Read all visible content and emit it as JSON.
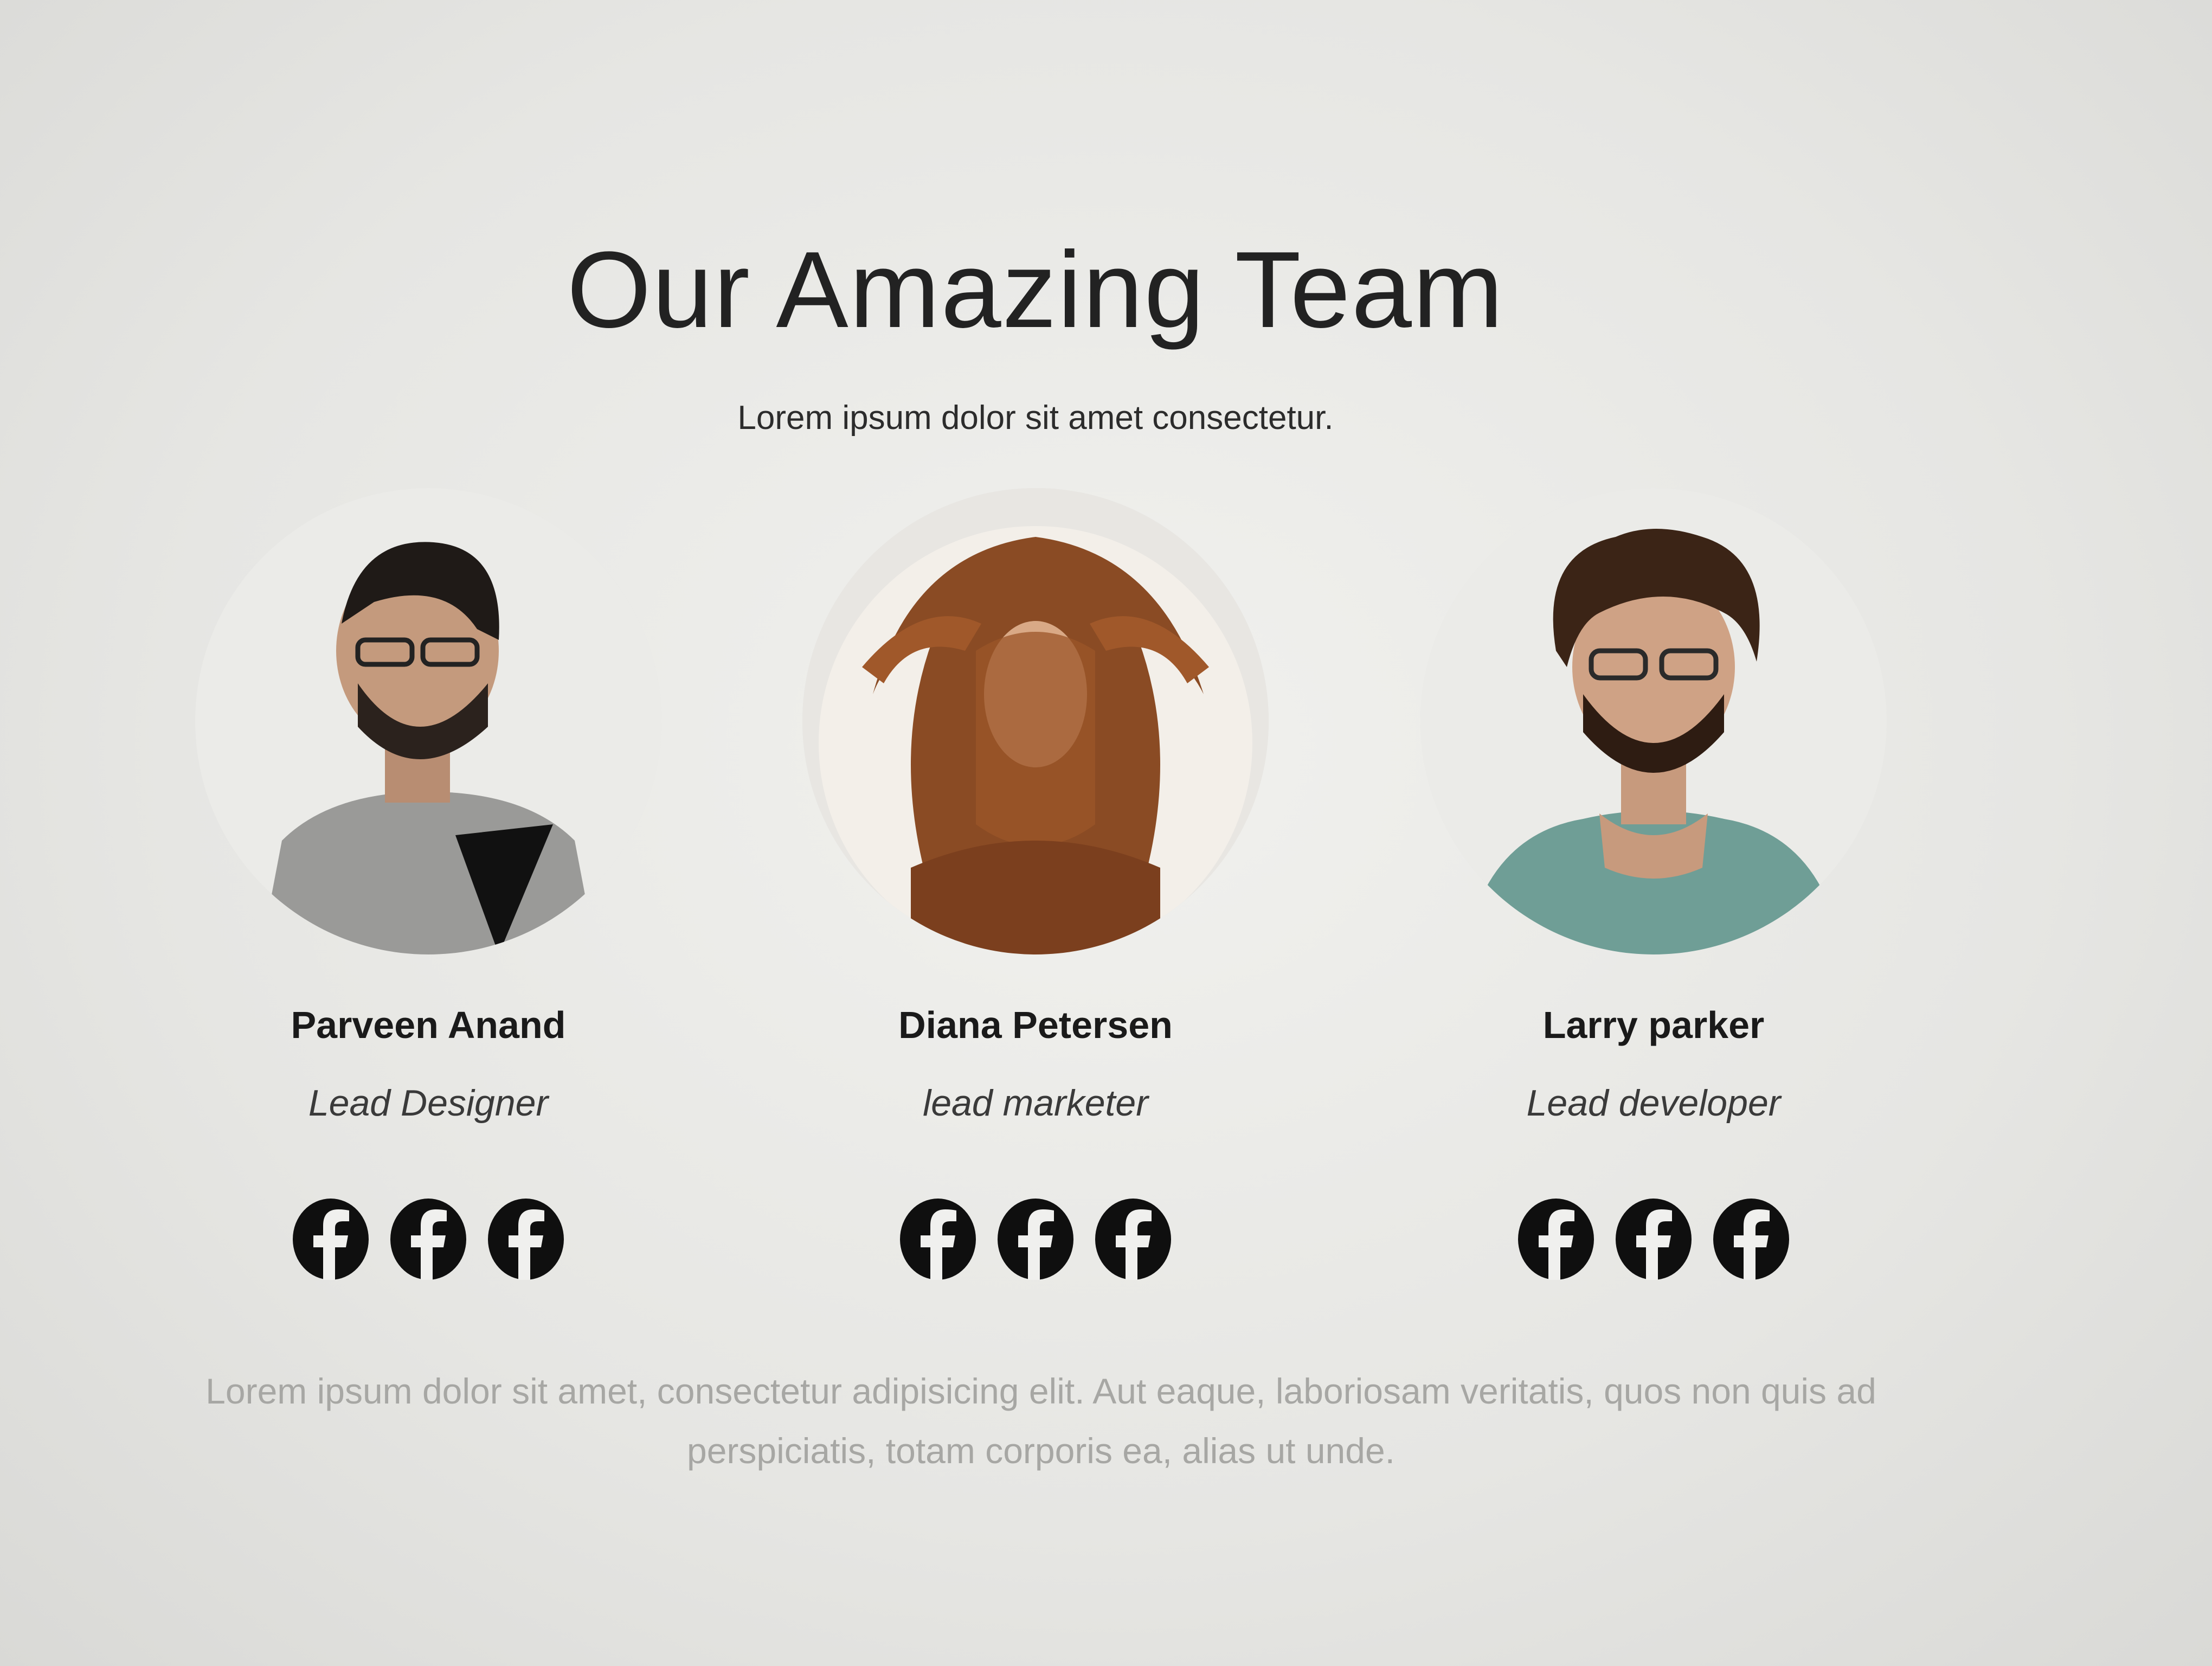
{
  "header": {
    "title": "Our Amazing Team",
    "subtitle": "Lorem ipsum dolor sit amet consectetur."
  },
  "team": [
    {
      "name": "Parveen Anand",
      "role": "Lead Designer",
      "social": [
        "facebook-icon",
        "facebook-icon",
        "facebook-icon"
      ]
    },
    {
      "name": "Diana Petersen",
      "role": "lead marketer",
      "social": [
        "facebook-icon",
        "facebook-icon",
        "facebook-icon"
      ]
    },
    {
      "name": "Larry parker",
      "role": "Lead developer",
      "social": [
        "facebook-icon",
        "facebook-icon",
        "facebook-icon"
      ]
    }
  ],
  "footer": {
    "text": "Lorem ipsum dolor sit amet, consectetur adipisicing elit. Aut eaque, laboriosam veritatis, quos non quis ad perspiciatis, totam corporis ea, alias ut unde."
  },
  "colors": {
    "background": "#e4e4e1",
    "text": "#1d1d1d",
    "icon": "#0f0f0f",
    "muted": "#a7a7a4"
  }
}
